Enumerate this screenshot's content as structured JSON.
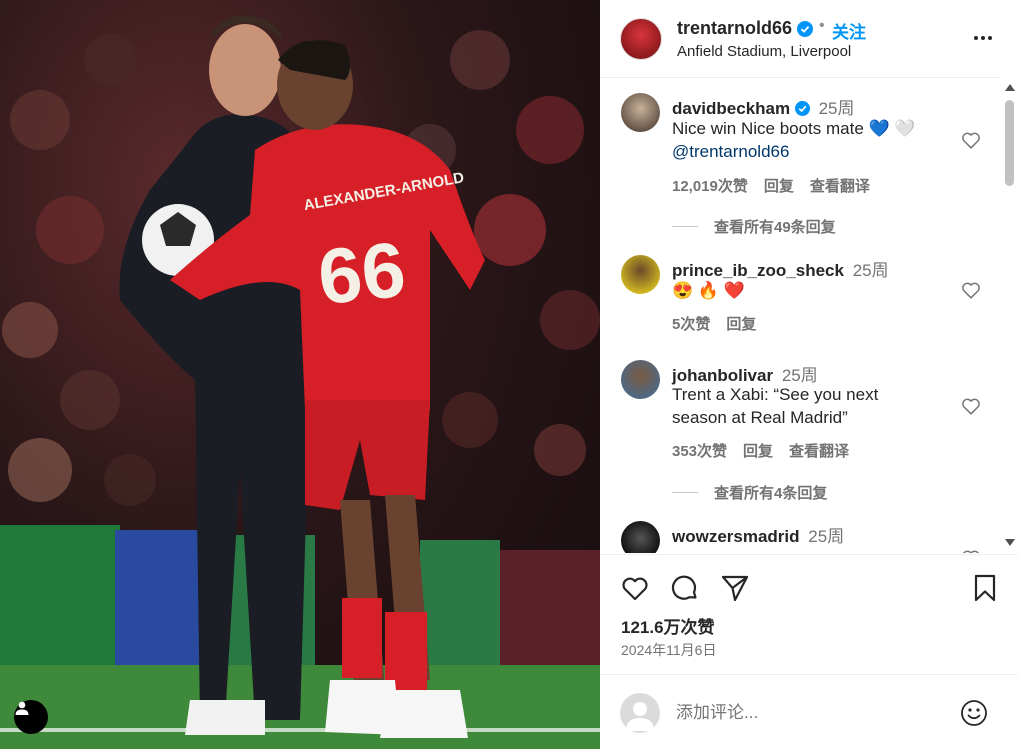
{
  "post": {
    "owner": "trentarnold66",
    "separator": "•",
    "follow_label": "关注",
    "location": "Anfield Stadium, Liverpool",
    "jersey_name": "ALEXANDER-ARNOLD",
    "jersey_number": "66"
  },
  "comments": [
    {
      "user": "davidbeckham",
      "time": "25周",
      "text": "Nice win Nice boots mate 💙 🤍",
      "mention": "@trentarnold66",
      "likes": "12,019次赞",
      "reply": "回复",
      "translate": "查看翻译",
      "view_replies": "查看所有49条回复"
    },
    {
      "user": "prince_ib_zoo_sheck",
      "time": "25周",
      "text": "😍 🔥 ❤️",
      "likes": "5次赞",
      "reply": "回复"
    },
    {
      "user": "johanbolivar",
      "time": "25周",
      "text": "Trent a Xabi: “See you next season at Real Madrid”",
      "likes": "353次赞",
      "reply": "回复",
      "translate": "查看翻译",
      "view_replies": "查看所有4条回复"
    },
    {
      "user": "wowzersmadrid",
      "time": "25周"
    }
  ],
  "actions": {
    "likes_count": "121.6万次赞",
    "date": "2024年11月6日"
  },
  "comment_box": {
    "placeholder": "添加评论..."
  },
  "colors": {
    "accent": "#0095f6",
    "verified": "#0095f6",
    "mention": "#00376b",
    "jersey": "#d61f26"
  }
}
